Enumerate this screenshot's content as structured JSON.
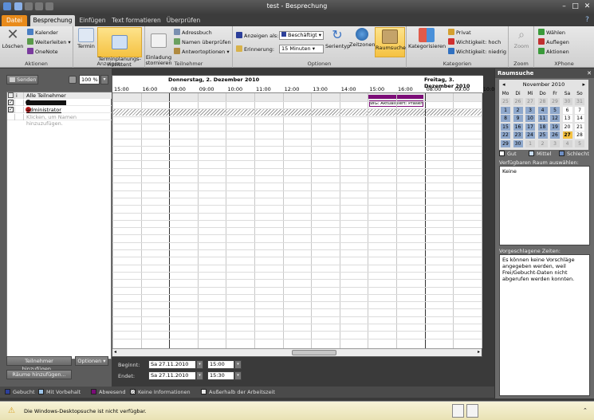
{
  "window": {
    "title": "test - Besprechung",
    "minimize": "–",
    "maximize": "□",
    "close": "✕"
  },
  "tabs": [
    {
      "label": "Datei",
      "kind": "file"
    },
    {
      "label": "Besprechung",
      "kind": "active"
    },
    {
      "label": "Einfügen",
      "kind": "normal"
    },
    {
      "label": "Text formatieren",
      "kind": "normal"
    },
    {
      "label": "Überprüfen",
      "kind": "normal"
    }
  ],
  "ribbon": {
    "aktionen": {
      "label": "Aktionen",
      "delete": "Löschen",
      "calendar": "Kalender",
      "forward": "Weiterleiten",
      "onenote": "OneNote"
    },
    "anzeigen": {
      "label": "Anzeigen",
      "appointment": "Termin",
      "scheduling": "Terminplanungs-\nAssistent"
    },
    "teilnehmer": {
      "label": "Teilnehmer",
      "cancel": "Einladung\nstornieren",
      "addressbook": "Adressbuch",
      "check_names": "Namen überprüfen",
      "response": "Antwortoptionen"
    },
    "optionen": {
      "label": "Optionen",
      "show_as_label": "Anzeigen als:",
      "show_as_value": "Beschäftigt",
      "reminder_label": "Erinnerung:",
      "reminder_value": "15 Minuten",
      "recurrence": "Serientyp",
      "timezones": "Zeitzonen",
      "roomfinder": "Raumsuche"
    },
    "kategorien": {
      "label": "Kategorien",
      "categorize": "Kategorisieren",
      "private": "Privat",
      "high": "Wichtigkeit: hoch",
      "low": "Wichtigkeit: niedrig"
    },
    "zoom": {
      "label": "Zoom",
      "zoom": "Zoom"
    },
    "xphone": {
      "label": "XPhone",
      "dial": "Wählen",
      "hangup": "Auflegen",
      "actions": "Aktionen"
    }
  },
  "left": {
    "send": "Senden",
    "zoom": "100 %",
    "all_attendees": "Alle Teilnehmer",
    "attendees": [
      {
        "name": "administrator",
        "checked": true
      }
    ],
    "add_placeholder": "Klicken, um Namen hinzuzufügen.",
    "add_attendees": "Teilnehmer hinzufügen...",
    "options": "Optionen",
    "add_rooms": "Räume hinzufügen..."
  },
  "grid": {
    "days": [
      "Donnerstag, 2. Dezember 2010",
      "Freitag, 3. Dezember 2010"
    ],
    "times": [
      "15:00",
      "16:00",
      "08:00",
      "09:00",
      "10:00",
      "11:00",
      "12:00",
      "13:00",
      "14:00",
      "15:00",
      "16:00",
      "08:00",
      "09:00",
      "10:00"
    ],
    "busy_label": "WG: Aktualisiert: Präsentation"
  },
  "form": {
    "start_label": "Beginnt:",
    "start_date": "Sa 27.11.2010",
    "start_time": "15:00",
    "end_label": "Endet:",
    "end_date": "Sa 27.11.2010",
    "end_time": "15:30"
  },
  "legend": {
    "busy": "Gebucht",
    "tentative": "Mit Vorbehalt",
    "away": "Abwesend",
    "noinfo": "Keine Informationen",
    "outside": "Außerhalb der Arbeitszeit"
  },
  "status": {
    "message": "Die Windows-Desktopsuche ist nicht verfügbar."
  },
  "room_finder": {
    "title": "Raumsuche",
    "month": "November 2010",
    "weekdays": [
      "Mo",
      "Di",
      "Mi",
      "Do",
      "Fr",
      "Sa",
      "So"
    ],
    "weeks": [
      [
        "25",
        "26",
        "27",
        "28",
        "29",
        "30",
        "31"
      ],
      [
        "1",
        "2",
        "3",
        "4",
        "5",
        "6",
        "7"
      ],
      [
        "8",
        "9",
        "10",
        "11",
        "12",
        "13",
        "14"
      ],
      [
        "15",
        "16",
        "17",
        "18",
        "19",
        "20",
        "21"
      ],
      [
        "22",
        "23",
        "24",
        "25",
        "26",
        "27",
        "28"
      ],
      [
        "29",
        "30",
        "1",
        "2",
        "3",
        "4",
        "5"
      ]
    ],
    "legend_good": "Gut",
    "legend_fair": "Mittel",
    "legend_bad": "Schlecht",
    "choose_room_label": "Verfügbaren Raum auswählen:",
    "choose_room_value": "Keine",
    "suggested_label": "Vorgeschlagene Zeiten:",
    "suggested_text": "Es können keine Vorschläge angegeben werden, weil Frei/Gebucht-Daten nicht abgerufen werden konnten."
  },
  "colors": {
    "accent": "#e98b1b",
    "busy": "#7b0c77",
    "tentative": "#9ec5ea",
    "today": "#f5c242"
  }
}
